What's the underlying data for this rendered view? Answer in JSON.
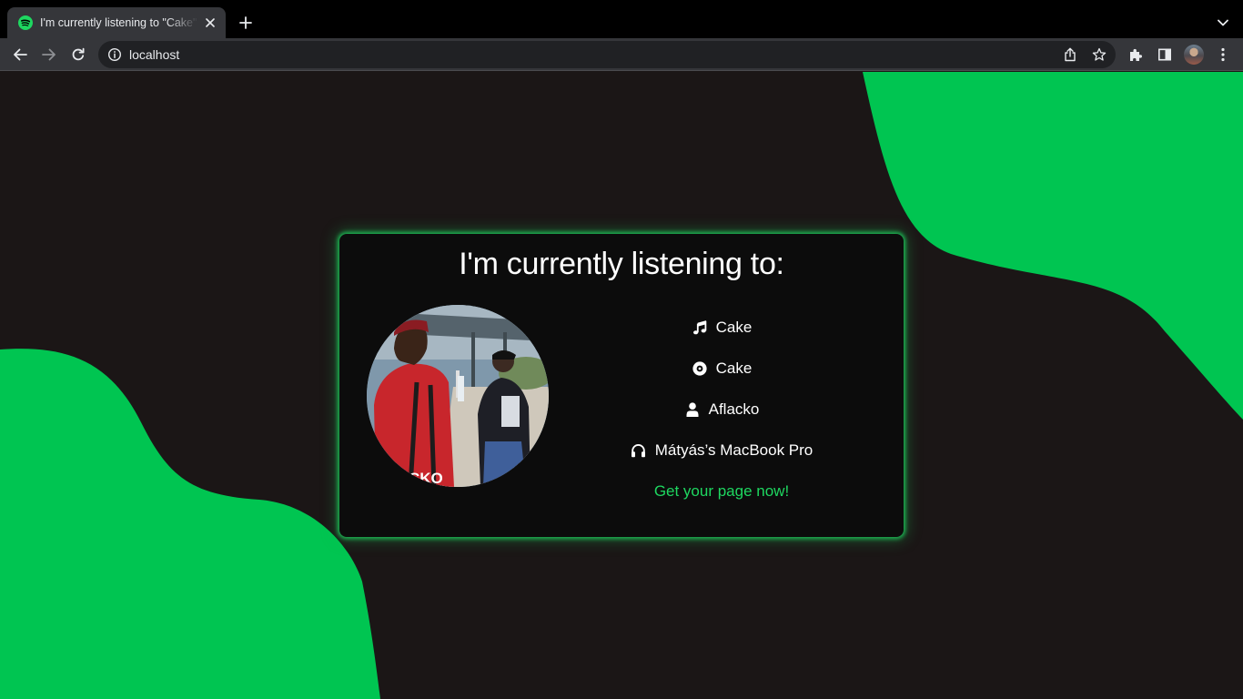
{
  "browser": {
    "tab": {
      "title": "I'm currently listening to \"Cake\"",
      "favicon": "spotify-icon"
    },
    "address_bar": {
      "url": "localhost",
      "security_icon": "info-icon"
    },
    "icons": [
      "back-arrow-icon",
      "forward-arrow-icon",
      "reload-icon",
      "share-icon",
      "bookmark-star-icon",
      "extensions-puzzle-icon",
      "side-panel-icon",
      "profile-avatar",
      "kebab-menu-icon",
      "tab-search-chevron-icon",
      "new-tab-plus-icon",
      "close-tab-icon"
    ]
  },
  "page": {
    "heading": "I'm currently listening to:",
    "album_art": {
      "caption": "CKO"
    },
    "track": {
      "icon": "music-note-icon",
      "label": "Cake"
    },
    "album": {
      "icon": "disc-icon",
      "label": "Cake"
    },
    "artist": {
      "icon": "user-icon",
      "label": "Aflacko"
    },
    "device": {
      "icon": "headphones-icon",
      "label": "Mátyás’s MacBook Pro"
    },
    "cta": "Get your page now!"
  },
  "colors": {
    "page_background": "#1b1616",
    "card_background": "#0c0c0c",
    "accent_green": "#00c551",
    "cta_green": "#1ed760",
    "card_glow": "#1db954",
    "text": "#ffffff"
  }
}
